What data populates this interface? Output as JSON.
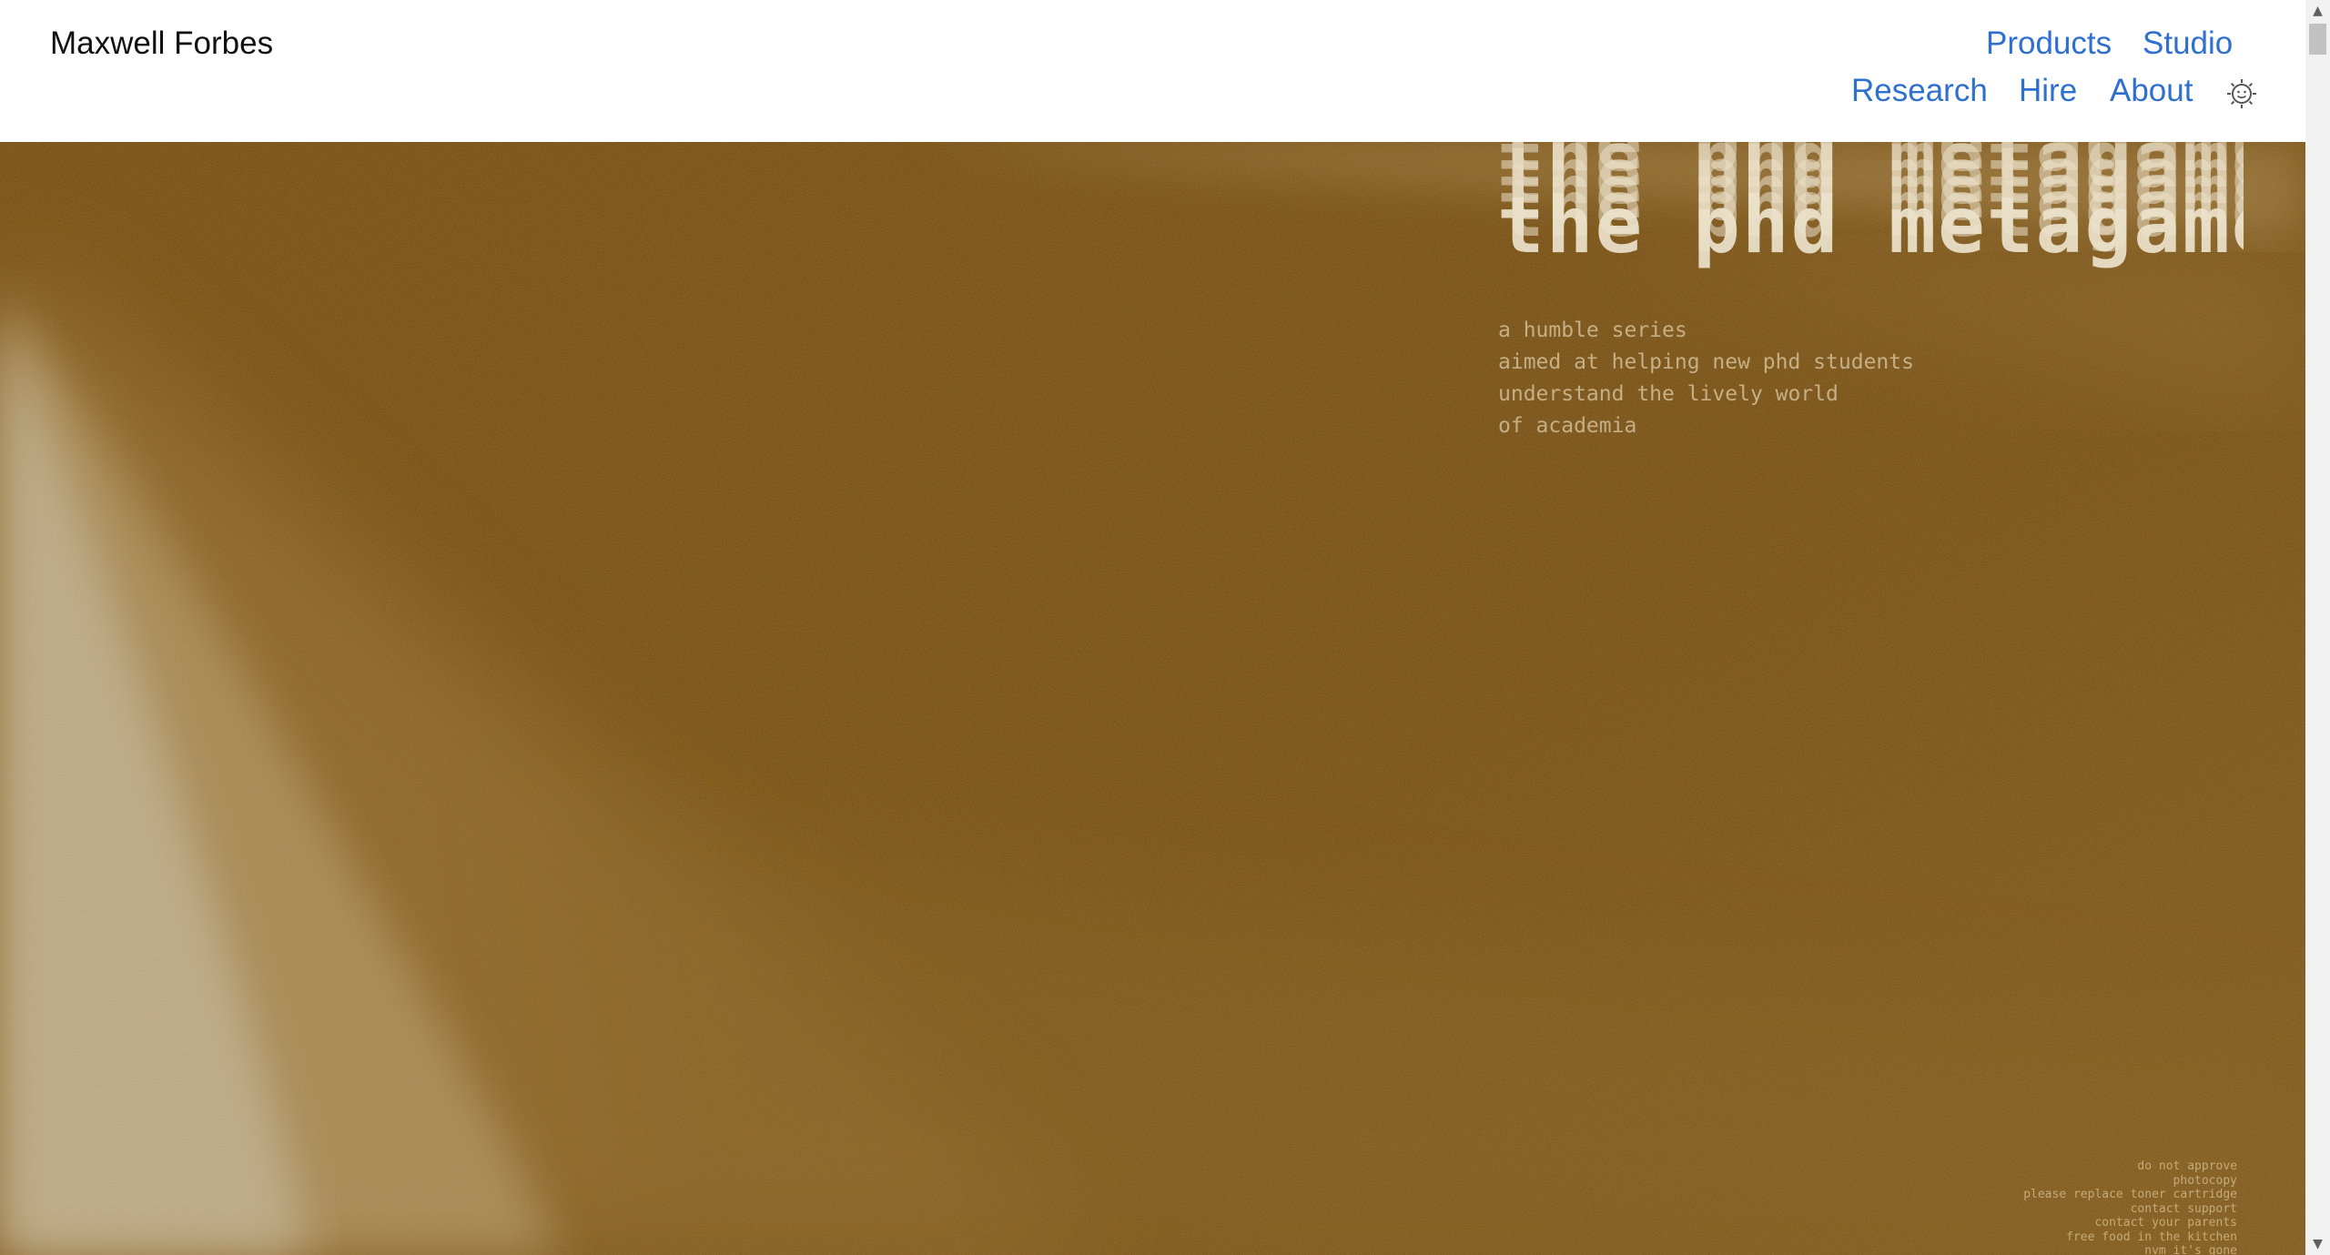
{
  "header": {
    "site_title": "Maxwell Forbes",
    "nav": {
      "products": "Products",
      "studio": "Studio",
      "research": "Research",
      "hire": "Hire",
      "about": "About"
    },
    "theme_icon": "sun-gear-icon",
    "link_color": "#2f6fcf"
  },
  "hero": {
    "title": "the phd metagame",
    "subtitle_lines": [
      "a humble series",
      "aimed at helping new phd students",
      "understand the lively world",
      "of academia"
    ],
    "footer_lines": [
      "do not approve",
      "photocopy",
      "please replace toner cartridge",
      "contact support",
      "contact your parents",
      "free food in the kitchen",
      "nvm it's gone"
    ],
    "background_color": "#72470c"
  },
  "scrollbar": {
    "up_icon": "scroll-up-arrow-icon",
    "down_icon": "scroll-down-arrow-icon"
  }
}
